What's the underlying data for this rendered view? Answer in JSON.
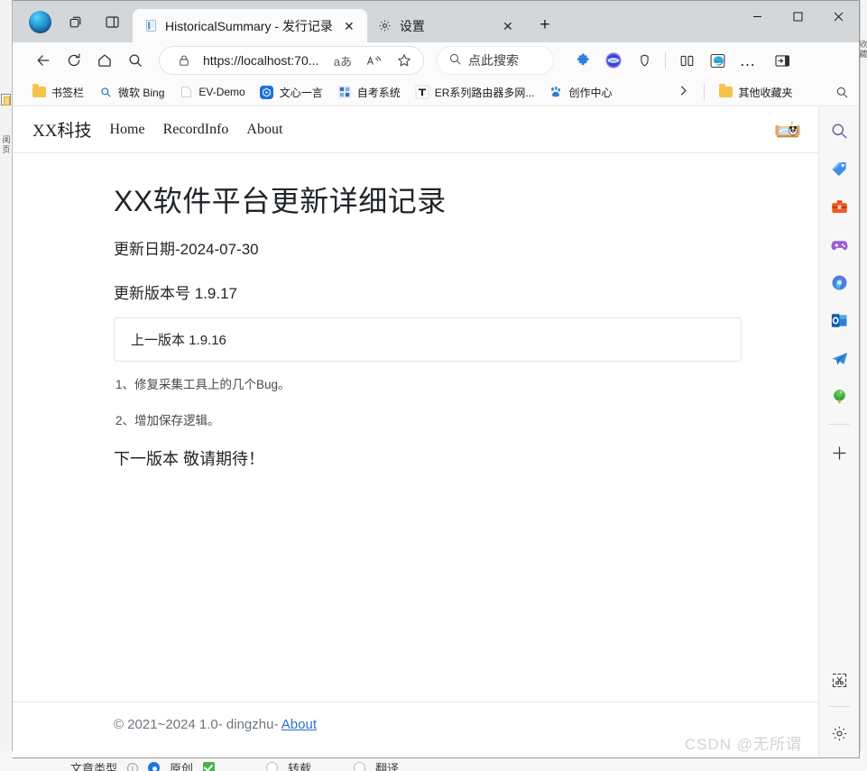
{
  "window": {
    "controls": {
      "minimize": "minimize-icon",
      "maximize": "maximize-icon",
      "close": "close-icon"
    }
  },
  "tabstrip": {
    "workspaces_icon": "workspaces-icon",
    "tab_actions_icon": "tab-actions-icon",
    "new_tab_label": "+",
    "tabs": [
      {
        "title": "HistoricalSummary - 发行记录",
        "favicon": "document-icon",
        "active": true,
        "close_label": "✕"
      },
      {
        "title": "设置",
        "favicon": "gear-icon",
        "active": false,
        "close_label": "✕"
      }
    ]
  },
  "toolbar": {
    "back_icon": "back-arrow-icon",
    "refresh_icon": "refresh-icon",
    "home_icon": "home-icon",
    "search_nav_icon": "search-icon",
    "address": {
      "lock_icon": "lock-icon",
      "url": "https://localhost:70...",
      "read_aloud_icon": "read-aloud-icon",
      "immersive_reader_icon": "immersive-reader-icon",
      "favorite_icon": "star-icon"
    },
    "search": {
      "icon": "search-icon",
      "placeholder": "点此搜索"
    },
    "extensions_icon": "extensions-puzzle-icon",
    "account_icon": "account-avatar-icon",
    "collections_icon": "collections-icon",
    "split_screen_icon": "split-screen-icon",
    "ie_mode_icon": "internet-explorer-icon",
    "more_icon": "more-options-icon",
    "sidebar_toggle_icon": "sidebar-toggle-icon"
  },
  "bookmarks": {
    "items": [
      {
        "label": "书签栏",
        "icon": "folder-icon"
      },
      {
        "label": "微软 Bing",
        "icon": "search-icon"
      },
      {
        "label": "EV-Demo",
        "icon": "page-icon"
      },
      {
        "label": "文心一言",
        "icon": "wenxin-icon"
      },
      {
        "label": "自考系统",
        "icon": "zikao-icon"
      },
      {
        "label": "ER系列路由器多网...",
        "icon": "text-t-icon"
      },
      {
        "label": "创作中心",
        "icon": "baidu-paw-icon"
      }
    ],
    "overflow_icon": "chevron-right-icon",
    "other_favorites": {
      "label": "其他收藏夹",
      "icon": "folder-icon"
    },
    "search_icon": "search-icon"
  },
  "site": {
    "navbar": {
      "brand": "XX科技",
      "links": [
        "Home",
        "RecordInfo",
        "About"
      ],
      "avatar_name": "panda-avatar"
    },
    "main": {
      "title": "XX软件平台更新详细记录",
      "update_date": "更新日期-2024-07-30",
      "version_label": "更新版本号",
      "version_value": "1.9.17",
      "previous_label": "上一版本",
      "previous_value": "1.9.16",
      "changes": [
        "1、修复采集工具上的几个Bug。",
        "2、增加保存逻辑。"
      ],
      "next_version": "下一版本 敬请期待！"
    },
    "footer": {
      "copyright": "© 2021~2024 1.0- dingzhu-",
      "link": "About"
    }
  },
  "rail": {
    "items": [
      {
        "icon": "search-icon",
        "name": "search"
      },
      {
        "icon": "shopping-tag-icon",
        "name": "shopping"
      },
      {
        "icon": "toolbox-icon",
        "name": "tools"
      },
      {
        "icon": "game-controller-icon",
        "name": "games"
      },
      {
        "icon": "copilot-icon",
        "name": "copilot"
      },
      {
        "icon": "outlook-icon",
        "name": "outlook"
      },
      {
        "icon": "telegram-plane-icon",
        "name": "telegram"
      },
      {
        "icon": "tree-icon",
        "name": "tree"
      }
    ],
    "add_icon": "plus-icon",
    "bottom": [
      {
        "icon": "screenshot-scissors-icon",
        "name": "web-capture"
      },
      {
        "icon": "gear-icon",
        "name": "customize"
      }
    ]
  },
  "behind": {
    "watermark": "CSDN @无所谓",
    "left_chars": "阅页",
    "right_chars": "收藏",
    "bottom_bar": {
      "label": "文章类型",
      "info_icon": "info-icon",
      "options": [
        {
          "label": "原创",
          "selected": true
        },
        {
          "label": "转载",
          "selected": false
        },
        {
          "label": "翻译",
          "selected": false
        }
      ]
    }
  },
  "colors": {
    "accent": "#0f6cbd",
    "link": "#2f6fd0",
    "tab_active_bg": "#fbfbfb",
    "titlebar_bg": "#d4d7da",
    "page_bg": "#ffffff",
    "muted_text": "#6c757d"
  }
}
